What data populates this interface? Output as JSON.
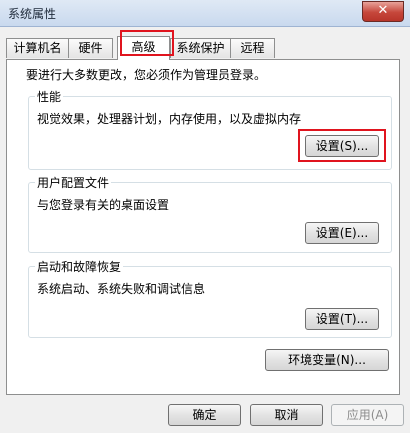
{
  "window": {
    "title": "系统属性",
    "close_label": "✕"
  },
  "tabs": [
    {
      "label": "计算机名",
      "active": false
    },
    {
      "label": "硬件",
      "active": false
    },
    {
      "label": "高级",
      "active": true
    },
    {
      "label": "系统保护",
      "active": false
    },
    {
      "label": "远程",
      "active": false
    }
  ],
  "admin_note": "要进行大多数更改，您必须作为管理员登录。",
  "performance": {
    "title": "性能",
    "description": "视觉效果，处理器计划，内存使用，以及虚拟内存",
    "settings_label": "设置(S)..."
  },
  "user_profiles": {
    "title": "用户配置文件",
    "description": "与您登录有关的桌面设置",
    "settings_label": "设置(E)..."
  },
  "startup_recovery": {
    "title": "启动和故障恢复",
    "description": "系统启动、系统失败和调试信息",
    "settings_label": "设置(T)..."
  },
  "env_vars_label": "环境变量(N)...",
  "footer": {
    "ok_label": "确定",
    "cancel_label": "取消",
    "apply_label": "应用(A)"
  },
  "highlight_color": "#e0141e"
}
